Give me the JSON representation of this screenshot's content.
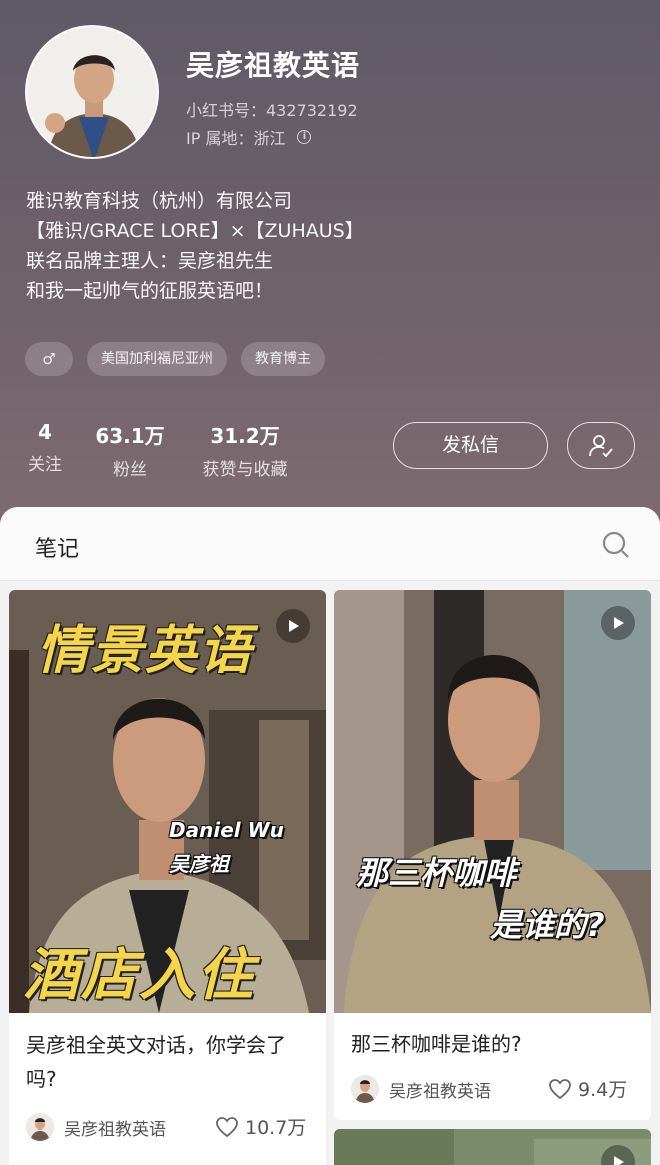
{
  "profile": {
    "name": "吴彦祖教英语",
    "redbook_id": "小红书号：432732192",
    "ip_location": "IP 属地：浙江",
    "bio": [
      "雅识教育科技（杭州）有限公司",
      "【雅识/GRACE LORE】×【ZUHAUS】",
      "联名品牌主理人：吴彦祖先生",
      "和我一起帅气的征服英语吧！"
    ],
    "tags": [
      {
        "icon": "male-icon",
        "glyph": "♂"
      },
      {
        "label": "美国加利福尼亚州"
      },
      {
        "label": "教育博主"
      }
    ],
    "stats": [
      {
        "num": "4",
        "label": "关注"
      },
      {
        "num": "63.1万",
        "label": "粉丝"
      },
      {
        "num": "31.2万",
        "label": "获赞与收藏"
      }
    ],
    "message_button": "发私信"
  },
  "notes": {
    "tab_title": "笔记",
    "cards": [
      {
        "overlay_top": "情景英语",
        "overlay_name_en": "Daniel Wu",
        "overlay_name_cn": "吴彦祖",
        "overlay_bottom": "酒店入住",
        "title": "吴彦祖全英文对话，你学会了吗?",
        "author": "吴彦祖教英语",
        "likes": "10.7万"
      },
      {
        "overlay_line1": "那三杯咖啡",
        "overlay_line2": "是谁的?",
        "title": "那三杯咖啡是谁的?",
        "author": "吴彦祖教英语",
        "likes": "9.4万"
      }
    ]
  },
  "colors": {
    "header_bg": "#6d6069",
    "accent_yellow": "#f5d54a"
  }
}
